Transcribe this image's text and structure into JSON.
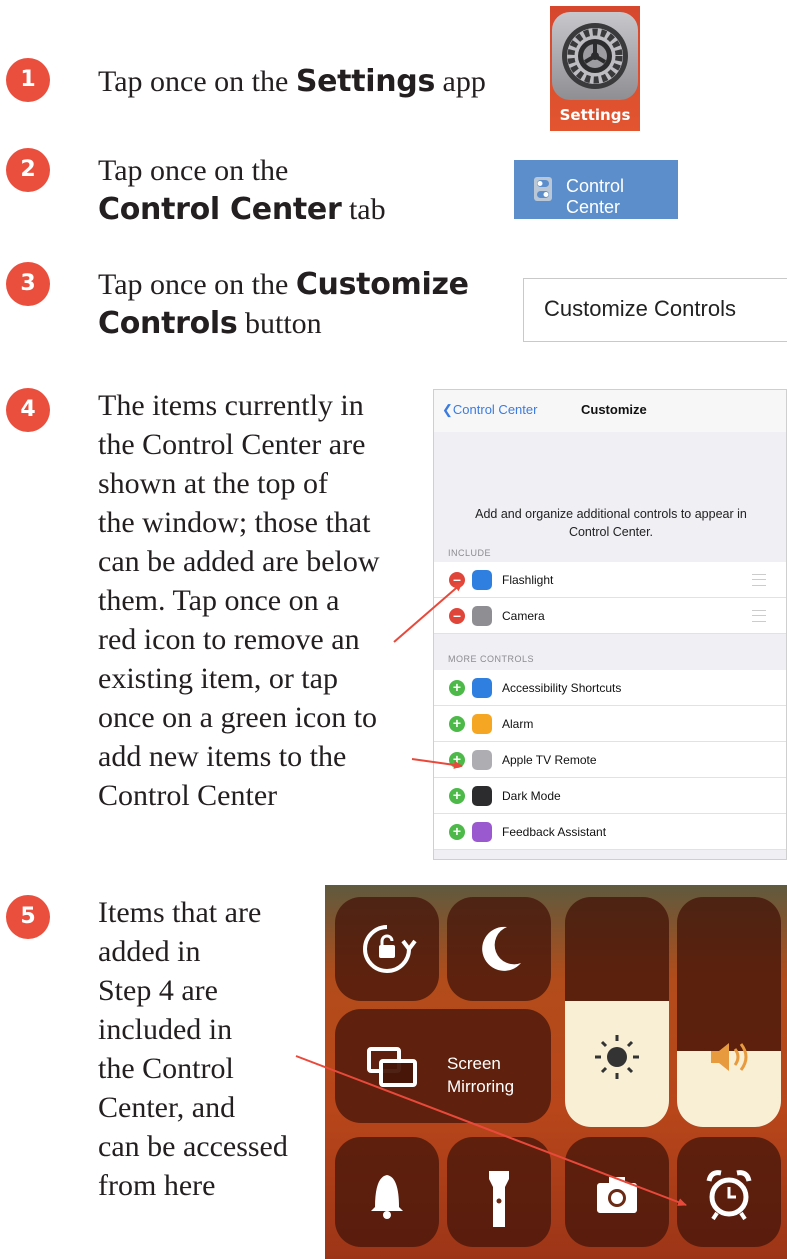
{
  "steps": [
    {
      "num": "1",
      "pre": "Tap once on the ",
      "bold": "Settings",
      "post": " app"
    },
    {
      "num": "2",
      "pre": "Tap once on the",
      "bold": "Control Center",
      "post": " tab"
    },
    {
      "num": "3",
      "pre": "Tap once on the ",
      "bold1": "Customize",
      "bold2": "Controls",
      "post": " button"
    },
    {
      "num": "4",
      "lines": [
        "The items currently in",
        "the Control Center are",
        "shown at the top of",
        "the window; those that",
        "can be added are below",
        "them. Tap once on a",
        "red icon to remove an",
        "existing item, or tap",
        "once on a green icon to",
        "add new items to the",
        "Control Center"
      ]
    },
    {
      "num": "5",
      "lines": [
        "Items that are",
        "added in",
        "Step 4 are",
        "included in",
        "the Control",
        "Center, and",
        "can be accessed",
        "from here"
      ]
    }
  ],
  "settings_icon": {
    "label": "Settings",
    "icon": "gear-icon"
  },
  "control_center_tab": {
    "label": "Control Center",
    "icon": "switches-icon"
  },
  "customize_button": {
    "label": "Customize Controls"
  },
  "customize_screen": {
    "back_label": "Control Center",
    "title": "Customize",
    "description_line1": "Add and organize additional controls to appear in",
    "description_line2": "Control Center.",
    "include_header": "INCLUDE",
    "more_header": "MORE CONTROLS",
    "included": [
      {
        "name": "Flashlight",
        "color": "#2f7fe0"
      },
      {
        "name": "Camera",
        "color": "#8e8e93"
      }
    ],
    "more": [
      {
        "name": "Accessibility Shortcuts",
        "color": "#2f7fe0"
      },
      {
        "name": "Alarm",
        "color": "#f5a623"
      },
      {
        "name": "Apple TV Remote",
        "color": "#aeaeb2"
      },
      {
        "name": "Dark Mode",
        "color": "#2c2c2e"
      },
      {
        "name": "Feedback Assistant",
        "color": "#9b59d0"
      }
    ]
  },
  "control_center": {
    "mirroring_line1": "Screen",
    "mirroring_line2": "Mirroring",
    "brightness_level": 0.55,
    "volume_level": 0.33
  },
  "colors": {
    "badge": "#ea4e3d",
    "arrow": "#e8493a"
  }
}
